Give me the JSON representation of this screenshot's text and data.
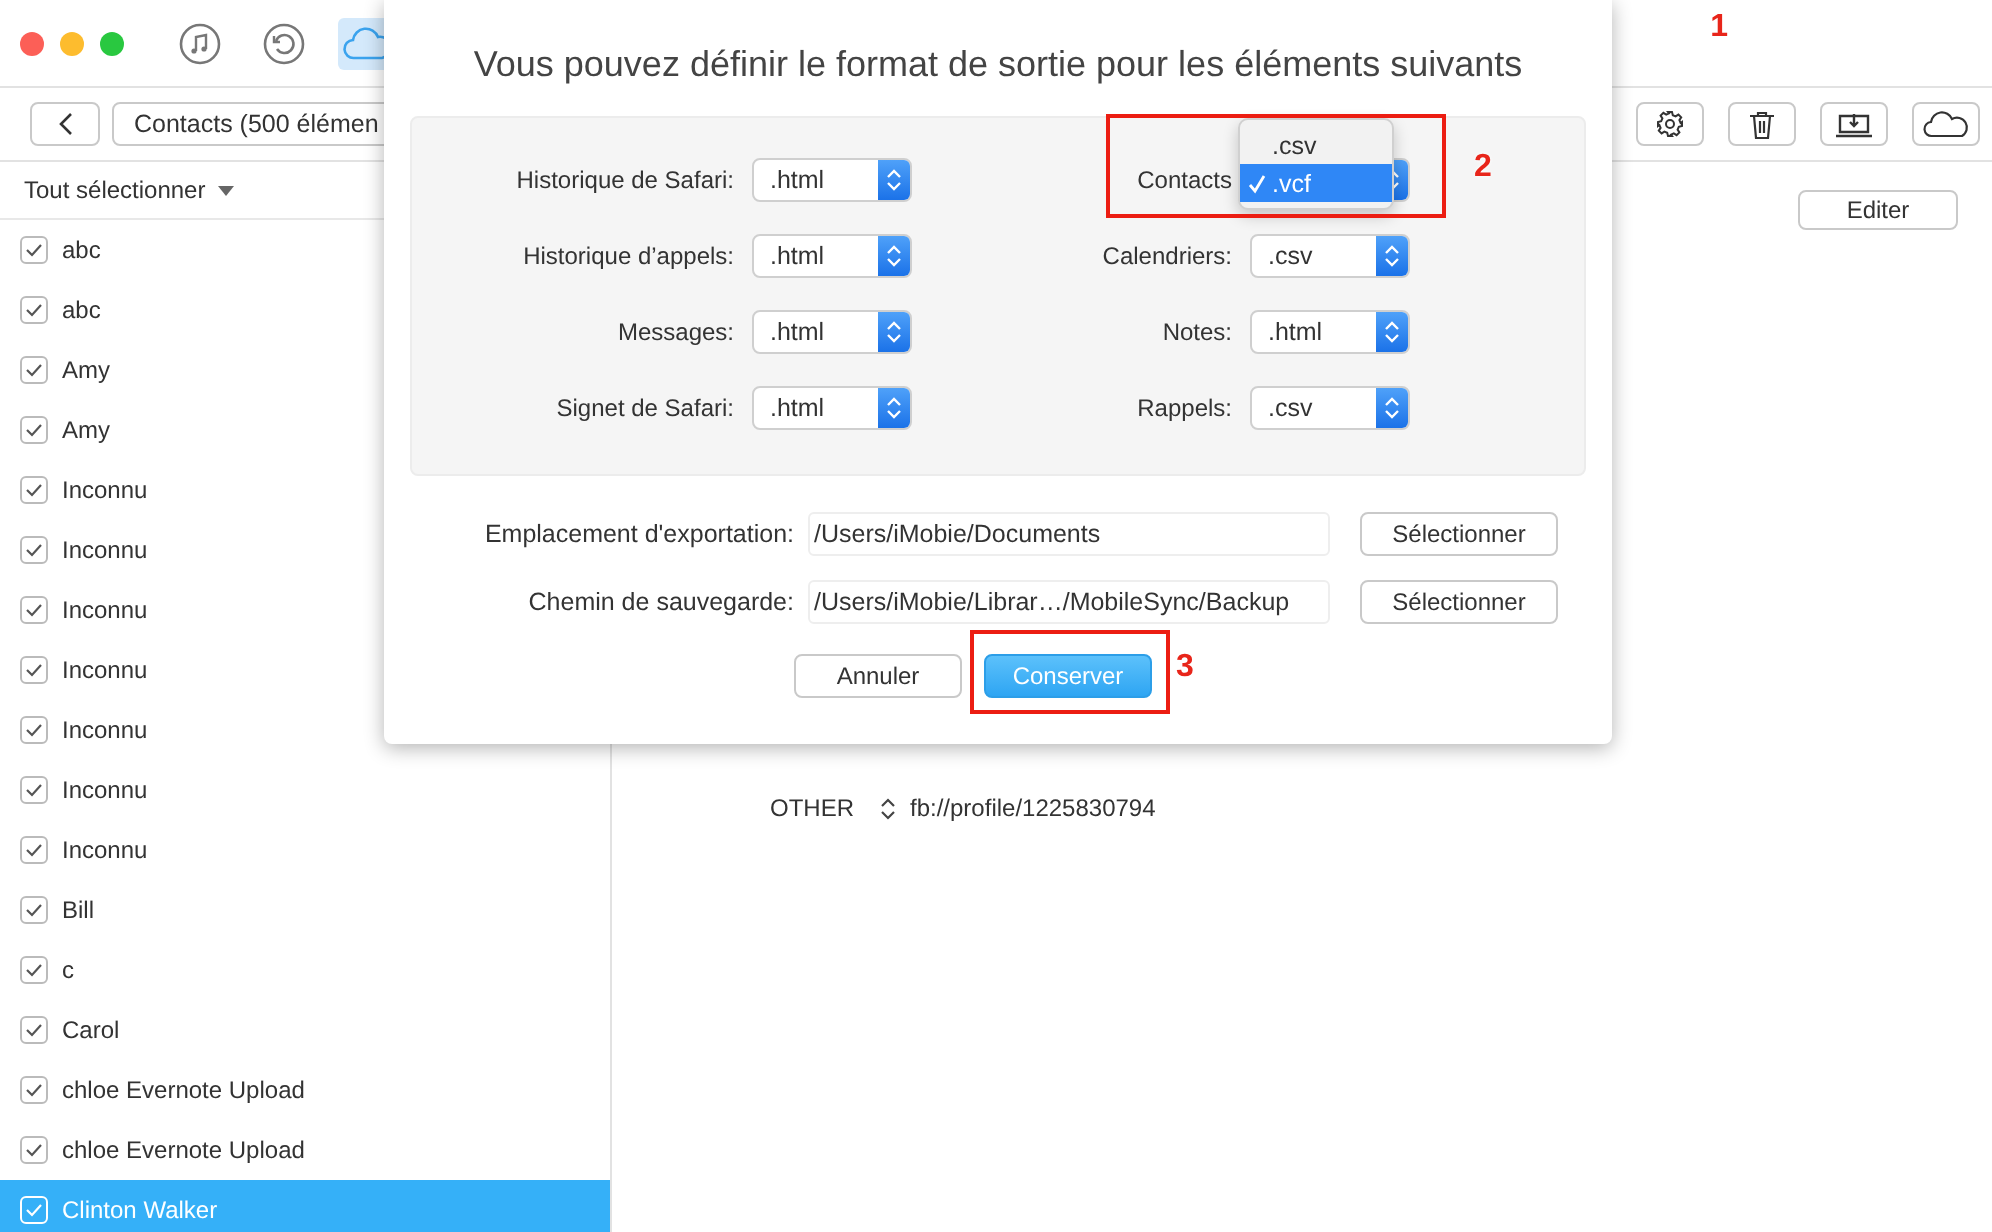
{
  "window": {
    "title_icons": [
      {
        "kind": "music",
        "selected": false
      },
      {
        "kind": "restore",
        "selected": false
      },
      {
        "kind": "cloud",
        "selected": true
      }
    ]
  },
  "toolbar": {
    "title": "Contacts (500 élémen",
    "buttons": [
      {
        "kind": "settings",
        "callout": "1"
      },
      {
        "kind": "trash"
      },
      {
        "kind": "export"
      },
      {
        "kind": "cloud"
      }
    ]
  },
  "sidebar": {
    "select_all": "Tout sélectionner",
    "items": [
      {
        "name": "abc",
        "checked": true,
        "selected": false
      },
      {
        "name": "abc",
        "checked": true,
        "selected": false
      },
      {
        "name": "Amy",
        "checked": true,
        "selected": false
      },
      {
        "name": "Amy",
        "checked": true,
        "selected": false
      },
      {
        "name": "Inconnu",
        "checked": true,
        "selected": false
      },
      {
        "name": "Inconnu",
        "checked": true,
        "selected": false
      },
      {
        "name": "Inconnu",
        "checked": true,
        "selected": false
      },
      {
        "name": "Inconnu",
        "checked": true,
        "selected": false
      },
      {
        "name": "Inconnu",
        "checked": true,
        "selected": false
      },
      {
        "name": "Inconnu",
        "checked": true,
        "selected": false
      },
      {
        "name": "Inconnu",
        "checked": true,
        "selected": false
      },
      {
        "name": "Bill",
        "checked": true,
        "selected": false
      },
      {
        "name": "c",
        "checked": true,
        "selected": false
      },
      {
        "name": "Carol",
        "checked": true,
        "selected": false
      },
      {
        "name": "chloe Evernote Upload",
        "checked": true,
        "selected": false
      },
      {
        "name": "chloe Evernote Upload",
        "checked": true,
        "selected": false
      },
      {
        "name": "Clinton Walker",
        "checked": true,
        "selected": true
      }
    ]
  },
  "detail": {
    "edit_button": "Editer",
    "field": {
      "label": "OTHER",
      "value": "fb://profile/1225830794"
    }
  },
  "dialog": {
    "title": "Vous pouvez définir le format de sortie pour les éléments suivants",
    "formats": [
      {
        "label": "Historique de Safari:",
        "value": ".html",
        "kind": "select"
      },
      {
        "label": "Contacts",
        "kind": "open-menu",
        "highlighted": true,
        "callout": "2",
        "options": [
          {
            "label": ".csv",
            "selected": false
          },
          {
            "label": ".vcf",
            "selected": true
          }
        ]
      },
      {
        "label": "Historique d’appels:",
        "value": ".html",
        "kind": "select"
      },
      {
        "label": "Calendriers:",
        "value": ".csv",
        "kind": "select"
      },
      {
        "label": "Messages:",
        "value": ".html",
        "kind": "select"
      },
      {
        "label": "Notes:",
        "value": ".html",
        "kind": "select"
      },
      {
        "label": "Signet de Safari:",
        "value": ".html",
        "kind": "select"
      },
      {
        "label": "Rappels:",
        "value": ".csv",
        "kind": "select"
      }
    ],
    "paths": [
      {
        "label": "Emplacement d'exportation:",
        "value": "/Users/iMobie/Documents",
        "button": "Sélectionner"
      },
      {
        "label": "Chemin de sauvegarde:",
        "value": "/Users/iMobie/Librar…/MobileSync/Backup",
        "button": "Sélectionner"
      }
    ],
    "buttons": [
      {
        "label": "Annuler",
        "kind": "secondary",
        "highlighted": false
      },
      {
        "label": "Conserver",
        "kind": "primary",
        "highlighted": true,
        "callout": "3"
      }
    ]
  }
}
